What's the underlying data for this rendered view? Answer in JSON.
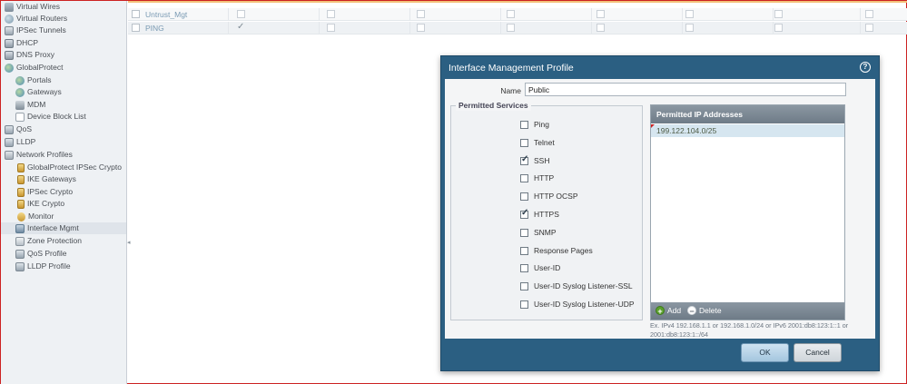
{
  "sidebar": {
    "items": [
      {
        "label": "Virtual Wires",
        "icon": "virtual-wire-icon"
      },
      {
        "label": "Virtual Routers",
        "icon": "virtual-router-icon"
      },
      {
        "label": "IPSec Tunnels",
        "icon": "ipsec-tunnel-icon"
      },
      {
        "label": "DHCP",
        "icon": "dhcp-icon"
      },
      {
        "label": "DNS Proxy",
        "icon": "dns-proxy-icon"
      },
      {
        "label": "GlobalProtect",
        "icon": "globalprotect-icon"
      },
      {
        "label": "Portals",
        "icon": "portal-icon"
      },
      {
        "label": "Gateways",
        "icon": "gateway-icon"
      },
      {
        "label": "MDM",
        "icon": "mdm-icon"
      },
      {
        "label": "Device Block List",
        "icon": "device-block-list-icon"
      },
      {
        "label": "QoS",
        "icon": "qos-icon"
      },
      {
        "label": "LLDP",
        "icon": "lldp-icon"
      },
      {
        "label": "Network Profiles",
        "icon": "network-profiles-icon"
      },
      {
        "label": "GlobalProtect IPSec Crypto",
        "icon": "lock-icon"
      },
      {
        "label": "IKE Gateways",
        "icon": "lock-icon"
      },
      {
        "label": "IPSec Crypto",
        "icon": "lock-icon"
      },
      {
        "label": "IKE Crypto",
        "icon": "lock-icon"
      },
      {
        "label": "Monitor",
        "icon": "monitor-icon"
      },
      {
        "label": "Interface Mgmt",
        "icon": "interface-mgmt-icon",
        "selected": true
      },
      {
        "label": "Zone Protection",
        "icon": "zone-protection-icon"
      },
      {
        "label": "QoS Profile",
        "icon": "qos-profile-icon"
      },
      {
        "label": "LLDP Profile",
        "icon": "lldp-profile-icon"
      }
    ]
  },
  "background_table": {
    "rows": [
      {
        "name": "Untrust_Mgt"
      },
      {
        "name": "PING"
      }
    ]
  },
  "dialog": {
    "title": "Interface Management Profile",
    "name_label": "Name",
    "name_value": "Public",
    "permitted_services_label": "Permitted Services",
    "services": [
      {
        "label": "Ping",
        "checked": false
      },
      {
        "label": "Telnet",
        "checked": false
      },
      {
        "label": "SSH",
        "checked": true
      },
      {
        "label": "HTTP",
        "checked": false
      },
      {
        "label": "HTTP OCSP",
        "checked": false
      },
      {
        "label": "HTTPS",
        "checked": true
      },
      {
        "label": "SNMP",
        "checked": false
      },
      {
        "label": "Response Pages",
        "checked": false
      },
      {
        "label": "User-ID",
        "checked": false
      },
      {
        "label": "User-ID Syslog Listener-SSL",
        "checked": false
      },
      {
        "label": "User-ID Syslog Listener-UDP",
        "checked": false
      }
    ],
    "permitted_ip_header": "Permitted IP Addresses",
    "permitted_ips": [
      "199.122.104.0/25"
    ],
    "add_label": "Add",
    "delete_label": "Delete",
    "hint": "Ex. IPv4 192.168.1.1 or 192.168.1.0/24 or IPv6 2001:db8:123:1::1 or 2001:db8:123:1::/64",
    "ok_label": "OK",
    "cancel_label": "Cancel"
  },
  "colors": {
    "dialog_header": "#2b5f82",
    "ok_button": "#a4c6de",
    "add_icon": "#5aa02c",
    "selected_ip_row": "#d6e6f0"
  }
}
